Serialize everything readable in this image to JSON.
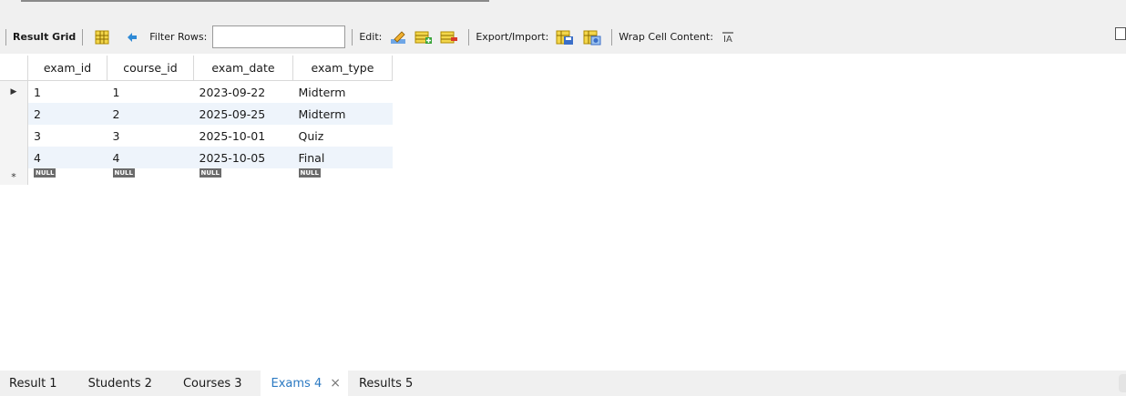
{
  "toolbar": {
    "result_grid": "Result Grid",
    "filter_rows": "Filter Rows:",
    "filter_value": "",
    "edit": "Edit:",
    "export_import": "Export/Import:",
    "wrap_cell_content": "Wrap Cell Content:"
  },
  "grid": {
    "columns": [
      "exam_id",
      "course_id",
      "exam_date",
      "exam_type"
    ],
    "rows": [
      [
        "1",
        "1",
        "2023-09-22",
        "Midterm"
      ],
      [
        "2",
        "2",
        "2025-09-25",
        "Midterm"
      ],
      [
        "3",
        "3",
        "2025-10-01",
        "Quiz"
      ],
      [
        "4",
        "4",
        "2025-10-05",
        "Final"
      ]
    ],
    "null_label": "NULL"
  },
  "tabs": [
    {
      "label": "Result 1"
    },
    {
      "label": "Students 2"
    },
    {
      "label": "Courses 3"
    },
    {
      "label": "Exams 4"
    },
    {
      "label": "Results 5"
    }
  ],
  "icons": {
    "grid": "grid-view-icon",
    "refresh": "refresh-icon",
    "edit": "edit-pencil-icon",
    "add_row": "add-row-icon",
    "delete_row": "delete-row-icon",
    "export": "export-icon",
    "import": "import-icon",
    "wrap": "wrap-text-icon"
  },
  "colors": {
    "active_tab_text": "#2b79c2",
    "alt_row": "#eef4fb",
    "toolbar_bg": "#f0f0f0"
  }
}
